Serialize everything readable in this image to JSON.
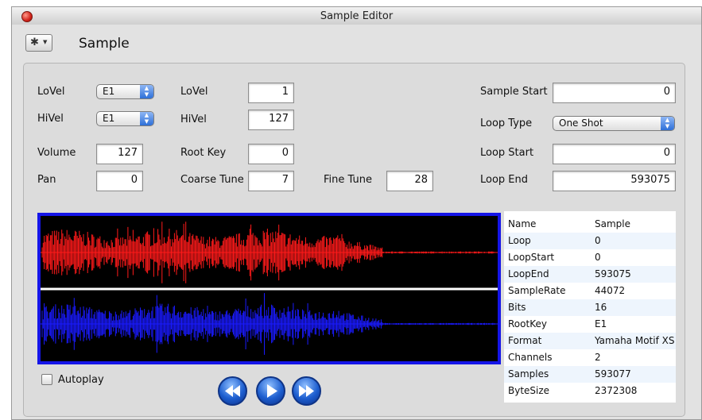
{
  "window": {
    "title": "Sample Editor"
  },
  "toolbar": {
    "heading": "Sample"
  },
  "left_labels": {
    "lovel": "LoVel",
    "hivel": "HiVel",
    "volume": "Volume",
    "pan": "Pan"
  },
  "mid_labels": {
    "lovel": "LoVel",
    "hivel": "HiVel",
    "root_key": "Root Key",
    "coarse_tune": "Coarse Tune",
    "fine_tune": "Fine Tune"
  },
  "right_labels": {
    "sample_start": "Sample Start",
    "loop_type": "Loop Type",
    "loop_start": "Loop Start",
    "loop_end": "Loop End"
  },
  "fields": {
    "lovel_key": "E1",
    "hivel_key": "E1",
    "volume": "127",
    "pan": "0",
    "lovel_value": "1",
    "hivel_value": "127",
    "root_key": "0",
    "coarse_tune": "7",
    "fine_tune": "28",
    "sample_start": "0",
    "loop_type": "One Shot",
    "loop_start": "0",
    "loop_end": "593075"
  },
  "info": [
    {
      "key": "Name",
      "value": "Sample"
    },
    {
      "key": "Loop",
      "value": "0"
    },
    {
      "key": "LoopStart",
      "value": "0"
    },
    {
      "key": "LoopEnd",
      "value": "593075"
    },
    {
      "key": "SampleRate",
      "value": "44072"
    },
    {
      "key": "Bits",
      "value": "16"
    },
    {
      "key": "RootKey",
      "value": "E1"
    },
    {
      "key": "Format",
      "value": "Yamaha Motif XS ..."
    },
    {
      "key": "Channels",
      "value": "2"
    },
    {
      "key": "Samples",
      "value": "593077"
    },
    {
      "key": "ByteSize",
      "value": "2372308"
    }
  ],
  "autoplay": {
    "label": "Autoplay",
    "checked": false
  },
  "colors": {
    "left_channel": "#ff1a1a",
    "right_channel": "#1a1aff",
    "waveform_border": "#1515e8"
  }
}
